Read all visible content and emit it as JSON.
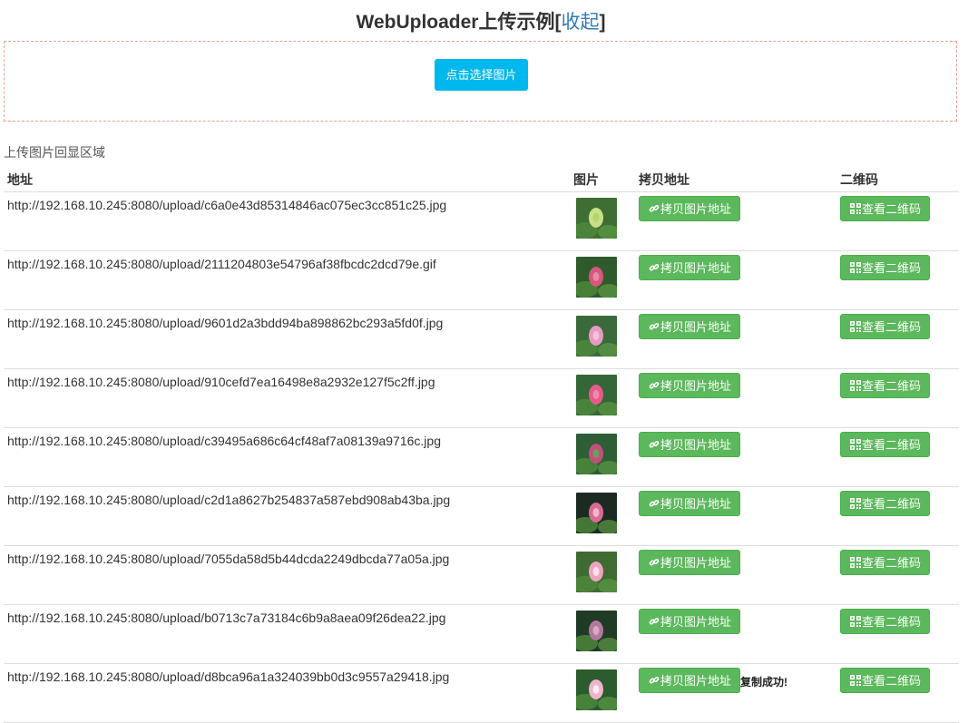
{
  "header": {
    "title": "WebUploader上传示例",
    "bracket_open": "[",
    "collapse_label": "收起",
    "bracket_close": "]"
  },
  "uploader": {
    "pick_button_label": "点击选择图片"
  },
  "result_section": {
    "label": "上传图片回显区域",
    "columns": [
      "地址",
      "图片",
      "拷贝地址",
      "二维码"
    ],
    "copy_button_label": "拷贝图片地址",
    "qr_button_label": "查看二维码",
    "copy_success_text": "复制成功!",
    "rows": [
      {
        "url": "http://192.168.10.245:8080/upload/c6a0e43d85314846ac075ec3cc851c25.jpg",
        "thumb": "green-bud"
      },
      {
        "url": "http://192.168.10.245:8080/upload/2111204803e54796af38fbcdc2dcd79e.gif",
        "thumb": "pink-pair"
      },
      {
        "url": "http://192.168.10.245:8080/upload/9601d2a3bdd94ba898862bc293a5fd0f.jpg",
        "thumb": "pink-open"
      },
      {
        "url": "http://192.168.10.245:8080/upload/910cefd7ea16498e8a2932e127f5c2ff.jpg",
        "thumb": "pink-bud"
      },
      {
        "url": "http://192.168.10.245:8080/upload/c39495a686c64cf48af7a08139a9716c.jpg",
        "thumb": "leaf-small"
      },
      {
        "url": "http://192.168.10.245:8080/upload/c2d1a8627b254837a587ebd908ab43ba.jpg",
        "thumb": "dark-pink"
      },
      {
        "url": "http://192.168.10.245:8080/upload/7055da58d5b44dcda2249dbcda77a05a.jpg",
        "thumb": "multi-pink"
      },
      {
        "url": "http://192.168.10.245:8080/upload/b0713c7a73184c6b9a8aea09f26dea22.jpg",
        "thumb": "dark-green"
      },
      {
        "url": "http://192.168.10.245:8080/upload/d8bca96a1a324039bb0d3c9557a29418.jpg",
        "thumb": "pink-white",
        "copied": true
      }
    ]
  },
  "colors": {
    "pick_button": "#00b7ee",
    "action_button": "#5cb85c",
    "link": "#337ab7",
    "upload_border": "#e4a08f"
  }
}
